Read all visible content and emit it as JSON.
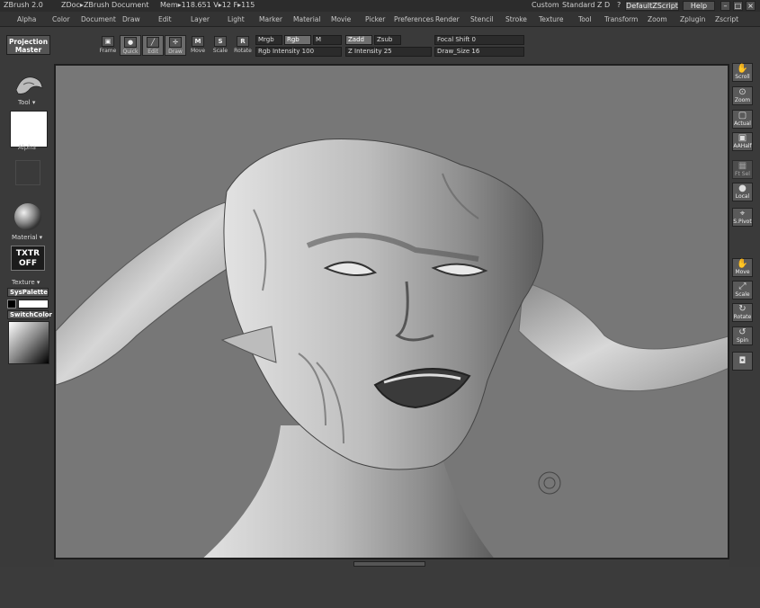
{
  "titlebar": {
    "app": "ZBrush 2.0",
    "doc": "ZDoc▸ZBrush Document",
    "stats": "Mem▸118.651  V▸12  F▸115",
    "custom": "Custom",
    "standard": "Standard Z D",
    "help_q": "?",
    "script": "DefaultZScript",
    "help": "Help"
  },
  "menu": [
    "Alpha",
    "Color",
    "Document",
    "Draw",
    "Edit",
    "Layer",
    "Light",
    "Marker",
    "Material",
    "Movie",
    "Picker",
    "Preferences",
    "Render",
    "Stencil",
    "Stroke",
    "Texture",
    "Tool",
    "Transform",
    "Zoom",
    "Zplugin",
    "Zscript"
  ],
  "toolbar": {
    "projection_master": "Projection Master",
    "buttons": [
      {
        "icon": "▣",
        "label": "Frame"
      },
      {
        "icon": "●",
        "label": "Quick"
      },
      {
        "icon": "╱",
        "label": "Edit"
      },
      {
        "icon": "✢",
        "label": "Draw"
      },
      {
        "icon": "M",
        "label": "Move"
      },
      {
        "icon": "S",
        "label": "Scale"
      },
      {
        "icon": "R",
        "label": "Rotate"
      }
    ],
    "mrgb": "Mrgb",
    "rgb": "Rgb",
    "m": "M",
    "rgb_intensity": "Rgb  Intensity 100",
    "zadd": "Zadd",
    "zsub": "Zsub",
    "z_intensity": "Z  Intensity 25",
    "focal_shift": "Focal  Shift 0",
    "draw_size": "Draw_Size 16"
  },
  "leftpanel": {
    "tool_label": "Tool",
    "alpha_label": "Alpha",
    "material_label": "Material",
    "txtr_line1": "TXTR",
    "txtr_line2": "OFF",
    "texture_label": "Texture",
    "syspalette": "SysPalette",
    "switchcolor": "SwitchColor"
  },
  "rightpanel": [
    {
      "icon": "✋",
      "label": "Scroll"
    },
    {
      "icon": "⊙",
      "label": "Zoom"
    },
    {
      "icon": "▢",
      "label": "Actual"
    },
    {
      "icon": "▣",
      "label": "AAHalf"
    },
    {
      "icon": "▦",
      "label": "Ft Sel"
    },
    {
      "icon": "●",
      "label": "Local"
    },
    {
      "icon": "⌖",
      "label": "S.Pivot"
    },
    {
      "icon": "✋",
      "label": "Move"
    },
    {
      "icon": "⤢",
      "label": "Scale"
    },
    {
      "icon": "↻",
      "label": "Rotate"
    },
    {
      "icon": "↺",
      "label": "Spin"
    },
    {
      "icon": "◘",
      "label": ""
    }
  ]
}
